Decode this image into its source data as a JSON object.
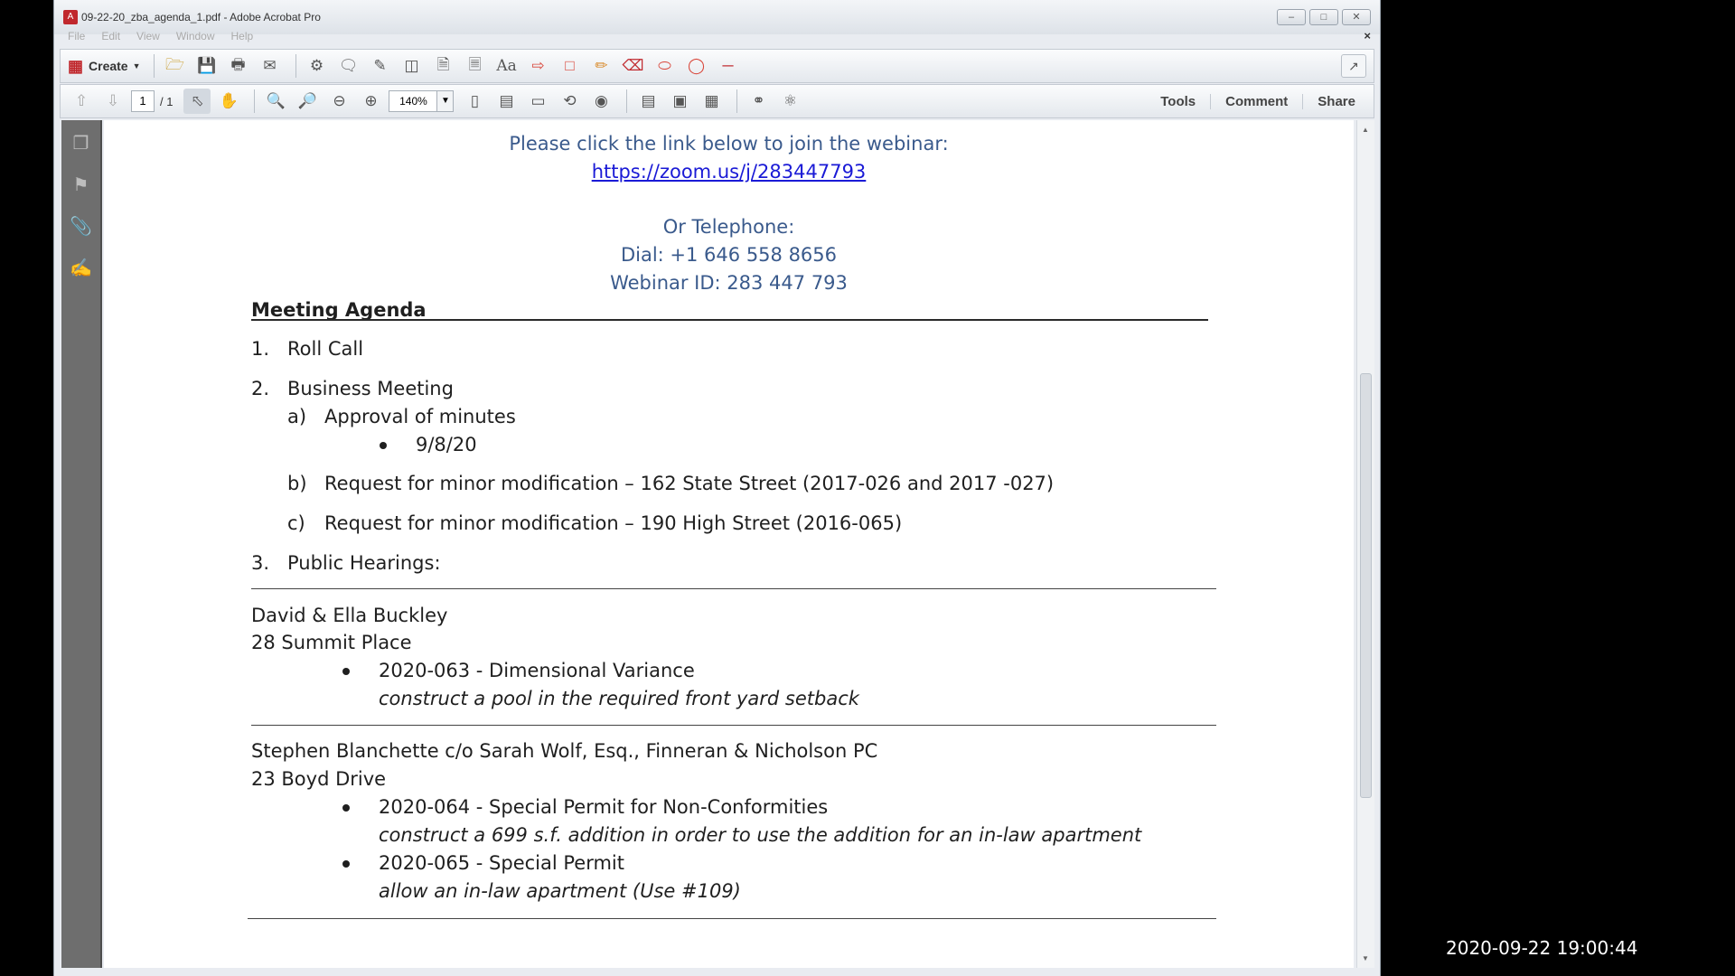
{
  "window": {
    "title": "09-22-20_zba_agenda_1.pdf - Adobe Acrobat Pro",
    "menu": [
      "File",
      "Edit",
      "View",
      "Window",
      "Help"
    ]
  },
  "toolbar": {
    "create_label": "Create",
    "page_current": "1",
    "page_total": "/ 1",
    "zoom": "140%",
    "tabs": [
      "Tools",
      "Comment",
      "Share"
    ]
  },
  "document": {
    "webinar_intro": "Please click the link below to join the webinar:",
    "webinar_link": "https://zoom.us/j/283447793",
    "telephone_heading": "Or Telephone:",
    "dial": "Dial: +1 646 558 8656",
    "webinar_id": "Webinar ID: 283 447 793",
    "agenda_title": "Meeting Agenda",
    "items": [
      {
        "num": "1.",
        "text": "Roll Call"
      },
      {
        "num": "2.",
        "text": "Business Meeting"
      },
      {
        "num": "3.",
        "text": "Public Hearings:"
      }
    ],
    "sub_items": [
      {
        "letter": "a)",
        "text": "Approval of minutes"
      },
      {
        "letter": "b)",
        "text": "Request for minor modification – 162 State Street (2017-026 and 2017 -027)"
      },
      {
        "letter": "c)",
        "text": "Request for minor modification – 190 High Street (2016-065)"
      }
    ],
    "minutes_date": "9/8/20",
    "hearings": [
      {
        "applicant": "David & Ella Buckley",
        "address": "28 Summit Place",
        "cases": [
          {
            "case": "2020-063 - Dimensional Variance",
            "desc": "construct a pool in the required front yard setback"
          }
        ]
      },
      {
        "applicant": "Stephen Blanchette c/o Sarah Wolf, Esq., Finneran & Nicholson PC",
        "address": "23 Boyd Drive",
        "cases": [
          {
            "case": "2020-064 - Special Permit for Non-Conformities",
            "desc": "construct a 699 s.f. addition in order to use the addition for an in-law apartment"
          },
          {
            "case": "2020-065 - Special Permit",
            "desc": "allow an in-law apartment (Use #109)"
          }
        ]
      }
    ]
  },
  "overlay": {
    "timestamp": "2020-09-22 19:00:44"
  }
}
